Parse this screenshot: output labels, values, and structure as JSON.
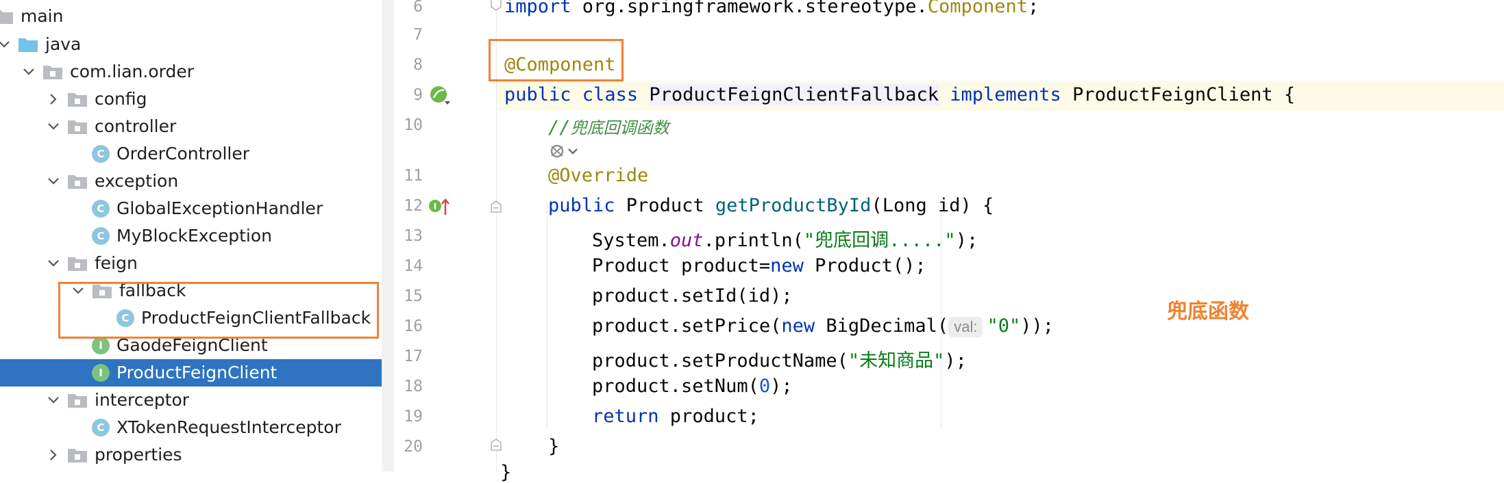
{
  "project_tree": {
    "items": [
      {
        "label": "main",
        "type": "folder"
      },
      {
        "label": "java",
        "type": "source-root"
      },
      {
        "label": "com.lian.order",
        "type": "package"
      },
      {
        "label": "config",
        "type": "package"
      },
      {
        "label": "controller",
        "type": "package"
      },
      {
        "label": "OrderController",
        "type": "class"
      },
      {
        "label": "exception",
        "type": "package"
      },
      {
        "label": "GlobalExceptionHandler",
        "type": "class"
      },
      {
        "label": "MyBlockException",
        "type": "class"
      },
      {
        "label": "feign",
        "type": "package"
      },
      {
        "label": "fallback",
        "type": "package"
      },
      {
        "label": "ProductFeignClientFallback",
        "type": "class"
      },
      {
        "label": "GaodeFeignClient",
        "type": "interface"
      },
      {
        "label": "ProductFeignClient",
        "type": "interface",
        "selected": true
      },
      {
        "label": "interceptor",
        "type": "package"
      },
      {
        "label": "XTokenRequestInterceptor",
        "type": "class"
      },
      {
        "label": "properties",
        "type": "package"
      }
    ],
    "class_icon_letter": "C",
    "interface_icon_letter": "I"
  },
  "editor": {
    "line_numbers": [
      "6",
      "7",
      "8",
      "9",
      "10",
      "11",
      "12",
      "13",
      "14",
      "15",
      "16",
      "17",
      "18",
      "19",
      "20"
    ],
    "code": {
      "l6_import": "import",
      "l6_pkg": " org.springframework.stereotype.",
      "l6_cls": "Component",
      "l6_semi": ";",
      "l8_ann": "@Component",
      "l9_public": "public",
      "l9_class": " class ",
      "l9_name": "ProductFeignClientFallback",
      "l9_implements": "implements",
      "l9_iface": " ProductFeignClient {",
      "l10_comment_slashes": "//",
      "l10_comment_text": "兜底回调函数",
      "l11_ann": "@Override",
      "l12_public": "public",
      "l12_type": " Product ",
      "l12_method": "getProductById",
      "l12_params": "(Long id) {",
      "l13_sys": "System.",
      "l13_out": "out",
      "l13_println": ".println(",
      "l13_str": "\"兜底回调.....\"",
      "l13_end": ");",
      "l14_a": "Product product=",
      "l14_new": "new",
      "l14_b": " Product();",
      "l15": "product.setId(id);",
      "l16_a": "product.setPrice(",
      "l16_new": "new",
      "l16_b": " BigDecimal(",
      "l16_hint": "val:",
      "l16_str": "\"0\"",
      "l16_end": "));",
      "l17_a": "product.setProductName(",
      "l17_str": "\"未知商品\"",
      "l17_end": ");",
      "l18_a": "product.setNum(",
      "l18_num": "0",
      "l18_end": ");",
      "l19_return": "return",
      "l19_b": " product;",
      "l20": "}"
    }
  },
  "annotation_label": "兜底函数",
  "colors": {
    "highlight_box": "#f2812e",
    "selection": "#2e74c0",
    "keyword": "#0033b3",
    "annotation": "#9e880d",
    "string": "#067d17"
  }
}
